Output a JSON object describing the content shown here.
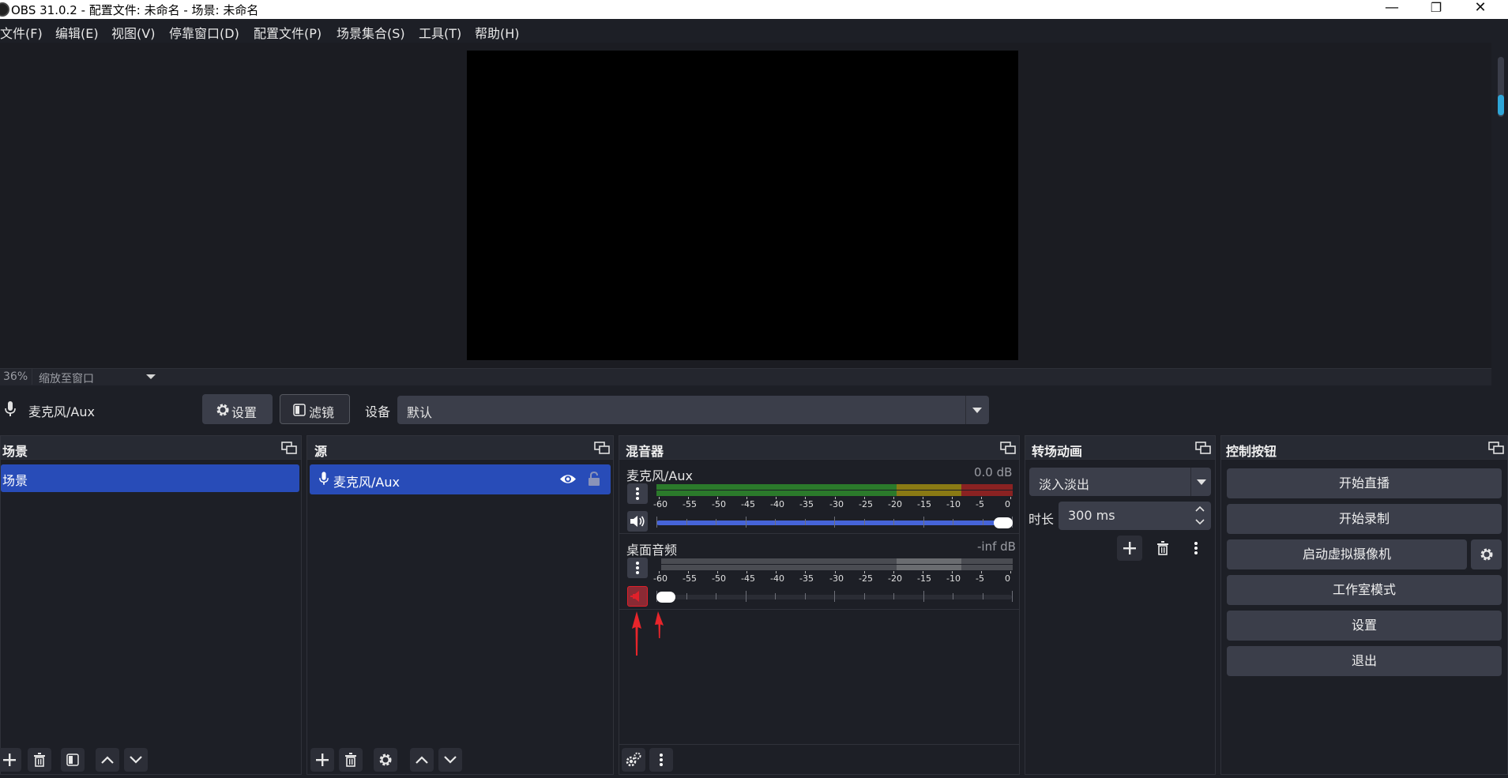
{
  "window": {
    "title": "OBS 31.0.2 - 配置文件: 未命名 - 场景: 未命名",
    "minimize_glyph": "—",
    "restore_glyph": "❐",
    "close_glyph": "✕"
  },
  "menubar": [
    "文件(F)",
    "编辑(E)",
    "视图(V)",
    "停靠窗口(D)",
    "配置文件(P)",
    "场景集合(S)",
    "工具(T)",
    "帮助(H)"
  ],
  "zoombar": {
    "zoom": "36%",
    "mode": "缩放至窗口"
  },
  "context_bar": {
    "source_name": "麦克风/Aux",
    "settings_label": "设置",
    "filters_label": "滤镜",
    "device_label": "设备",
    "device_value": "默认"
  },
  "scenes": {
    "title": "场景",
    "items": [
      "场景"
    ]
  },
  "sources": {
    "title": "源",
    "items": [
      "麦克风/Aux"
    ]
  },
  "mixer": {
    "title": "混音器",
    "ticks": [
      "-60",
      "-55",
      "-50",
      "-45",
      "-40",
      "-35",
      "-30",
      "-25",
      "-20",
      "-15",
      "-10",
      "-5",
      "0"
    ],
    "channels": [
      {
        "name": "麦克风/Aux",
        "db": "0.0 dB",
        "muted": false,
        "volume": 1.0
      },
      {
        "name": "桌面音频",
        "db": "-inf dB",
        "muted": true,
        "volume": 0.0
      }
    ]
  },
  "transitions": {
    "title": "转场动画",
    "selected": "淡入淡出",
    "duration_label": "时长",
    "duration_value": "300 ms"
  },
  "controls": {
    "title": "控制按钮",
    "buttons": [
      "开始直播",
      "开始录制",
      "启动虚拟摄像机",
      "工作室模式",
      "设置",
      "退出"
    ]
  },
  "colors": {
    "accent": "#284cb8",
    "meter_green": "#2b7a2b",
    "meter_yellow": "#8a7a14",
    "meter_red": "#8a2222",
    "mute_red": "#e0202a",
    "volume_blue": "#4664d8",
    "annotation_arrow": "#e8252b"
  }
}
